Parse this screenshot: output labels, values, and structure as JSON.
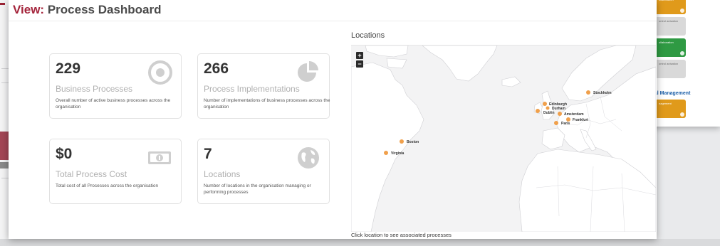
{
  "page": {
    "title_prefix": "View:",
    "title": "Process Dashboard"
  },
  "cards": [
    {
      "value": "229",
      "label": "Business Processes",
      "description": "Overall number of active business processes across the organisation",
      "icon": "target-icon"
    },
    {
      "value": "266",
      "label": "Process Implementations",
      "description": "Number of implementations of business processes across the organisation",
      "icon": "pie-chart-icon"
    },
    {
      "value": "$0",
      "label": "Total Process Cost",
      "description": "Total cost of all Processes across the organisation",
      "icon": "banknote-icon"
    },
    {
      "value": "7",
      "label": "Locations",
      "description": "Number of locations in the organisation managing or performing processes",
      "icon": "globe-icon"
    }
  ],
  "map": {
    "title": "Locations",
    "zoom_in": "+",
    "zoom_out": "−",
    "caption": "Click location to see associated processes",
    "marker_color": "#f0a04b",
    "locations": [
      {
        "name": "Stockholm"
      },
      {
        "name": "Edinburgh"
      },
      {
        "name": "Durham"
      },
      {
        "name": "Dublin"
      },
      {
        "name": "Amsterdam"
      },
      {
        "name": "Frankfurt"
      },
      {
        "name": "Paris"
      },
      {
        "name": "Boston"
      },
      {
        "name": "Virginia"
      }
    ]
  },
  "background_app": {
    "right_heading": "cial Management",
    "tiles": [
      "ollaboration",
      "ontrol\nanisation",
      "ollaboration",
      "ontrol\nanisation",
      "nagement"
    ]
  },
  "colors": {
    "accent": "#a4243b",
    "title": "#4a4a4a",
    "muted_label": "#b0b0b0",
    "icon": "#cfcfcf"
  }
}
